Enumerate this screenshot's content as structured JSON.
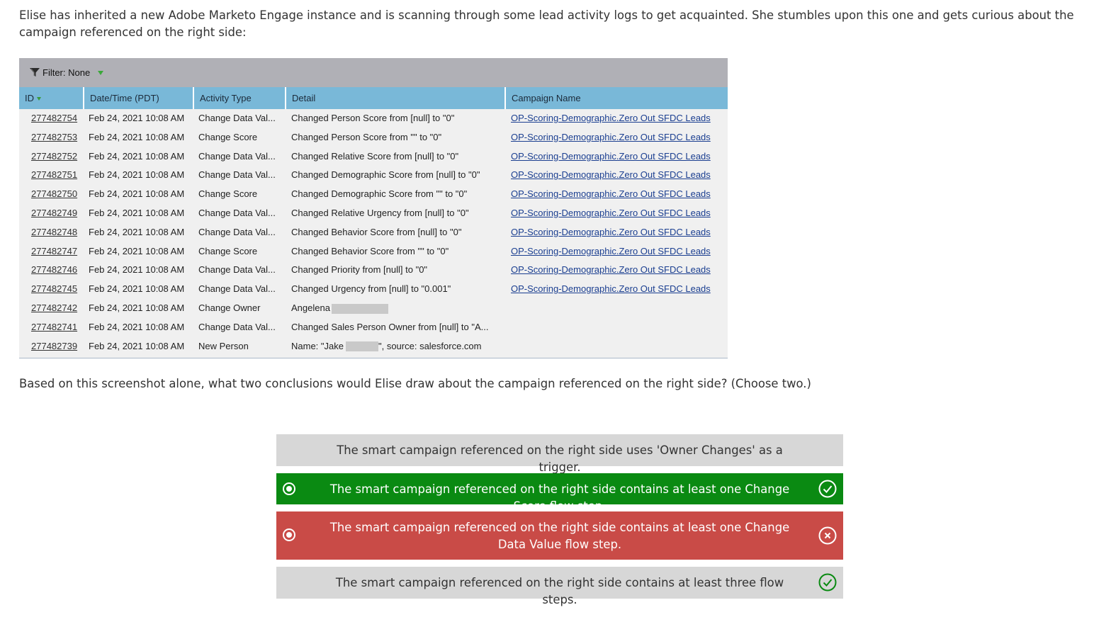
{
  "intro": "Elise has inherited a new Adobe Marketo Engage instance and is scanning through some lead activity logs to get acquainted. She stumbles upon this one and gets curious about the campaign referenced on the right side:",
  "log": {
    "filter_label": "Filter: None",
    "columns": {
      "id": "ID",
      "datetime": "Date/Time (PDT)",
      "activity_type": "Activity Type",
      "detail": "Detail",
      "campaign_name": "Campaign Name"
    },
    "rows": [
      {
        "id": "277482754",
        "datetime": "Feb 24, 2021 10:08 AM",
        "activity_type": "Change Data Val...",
        "detail": "Changed Person Score from [null] to \"0\"",
        "campaign": "OP-Scoring-Demographic.Zero Out SFDC Leads"
      },
      {
        "id": "277482753",
        "datetime": "Feb 24, 2021 10:08 AM",
        "activity_type": "Change Score",
        "detail": "Changed Person Score from \"\" to \"0\"",
        "campaign": "OP-Scoring-Demographic.Zero Out SFDC Leads"
      },
      {
        "id": "277482752",
        "datetime": "Feb 24, 2021 10:08 AM",
        "activity_type": "Change Data Val...",
        "detail": "Changed Relative Score from [null] to \"0\"",
        "campaign": "OP-Scoring-Demographic.Zero Out SFDC Leads"
      },
      {
        "id": "277482751",
        "datetime": "Feb 24, 2021 10:08 AM",
        "activity_type": "Change Data Val...",
        "detail": "Changed Demographic Score from [null] to \"0\"",
        "campaign": "OP-Scoring-Demographic.Zero Out SFDC Leads"
      },
      {
        "id": "277482750",
        "datetime": "Feb 24, 2021 10:08 AM",
        "activity_type": "Change Score",
        "detail": "Changed Demographic Score from \"\" to \"0\"",
        "campaign": "OP-Scoring-Demographic.Zero Out SFDC Leads"
      },
      {
        "id": "277482749",
        "datetime": "Feb 24, 2021 10:08 AM",
        "activity_type": "Change Data Val...",
        "detail": "Changed Relative Urgency from [null] to \"0\"",
        "campaign": "OP-Scoring-Demographic.Zero Out SFDC Leads"
      },
      {
        "id": "277482748",
        "datetime": "Feb 24, 2021 10:08 AM",
        "activity_type": "Change Data Val...",
        "detail": "Changed Behavior Score from [null] to \"0\"",
        "campaign": "OP-Scoring-Demographic.Zero Out SFDC Leads"
      },
      {
        "id": "277482747",
        "datetime": "Feb 24, 2021 10:08 AM",
        "activity_type": "Change Score",
        "detail": "Changed Behavior Score from \"\" to \"0\"",
        "campaign": "OP-Scoring-Demographic.Zero Out SFDC Leads"
      },
      {
        "id": "277482746",
        "datetime": "Feb 24, 2021 10:08 AM",
        "activity_type": "Change Data Val...",
        "detail": "Changed Priority from [null] to \"0\"",
        "campaign": "OP-Scoring-Demographic.Zero Out SFDC Leads"
      },
      {
        "id": "277482745",
        "datetime": "Feb 24, 2021 10:08 AM",
        "activity_type": "Change Data Val...",
        "detail": "Changed Urgency from [null] to \"0.001\"",
        "campaign": "OP-Scoring-Demographic.Zero Out SFDC Leads"
      },
      {
        "id": "277482742",
        "datetime": "Feb 24, 2021 10:08 AM",
        "activity_type": "Change Owner",
        "detail": "Angelena",
        "campaign": ""
      },
      {
        "id": "277482741",
        "datetime": "Feb 24, 2021 10:08 AM",
        "activity_type": "Change Data Val...",
        "detail": "Changed Sales Person Owner from [null] to \"A...",
        "campaign": ""
      },
      {
        "id": "277482739",
        "datetime": "Feb 24, 2021 10:08 AM",
        "activity_type": "New Person",
        "detail": "Name: \"Jake",
        "detail_suffix": "\", source: salesforce.com",
        "campaign": ""
      }
    ]
  },
  "question": "Based on this screenshot alone, what two conclusions would Elise draw about the campaign referenced on the right side? (Choose two.)",
  "options": [
    {
      "text": "The smart campaign referenced on the right side uses 'Owner Changes' as a trigger.",
      "state": "neutral"
    },
    {
      "text": "The smart campaign referenced on the right side contains at least one Change Score flow step.",
      "state": "correct-selected"
    },
    {
      "text": "The smart campaign referenced on the right side contains at least one Change Data Value flow step.",
      "state": "wrong-selected"
    },
    {
      "text": "The smart campaign referenced on the right side contains at least three flow steps.",
      "state": "correct-missed"
    }
  ],
  "colors": {
    "header_blue": "#79b8d8",
    "filter_gray": "#b0b0b6",
    "correct_green": "#0a8a12",
    "wrong_red": "#c94b47",
    "neutral_gray": "#d7d7d7",
    "link_blue": "#1a3e90"
  }
}
